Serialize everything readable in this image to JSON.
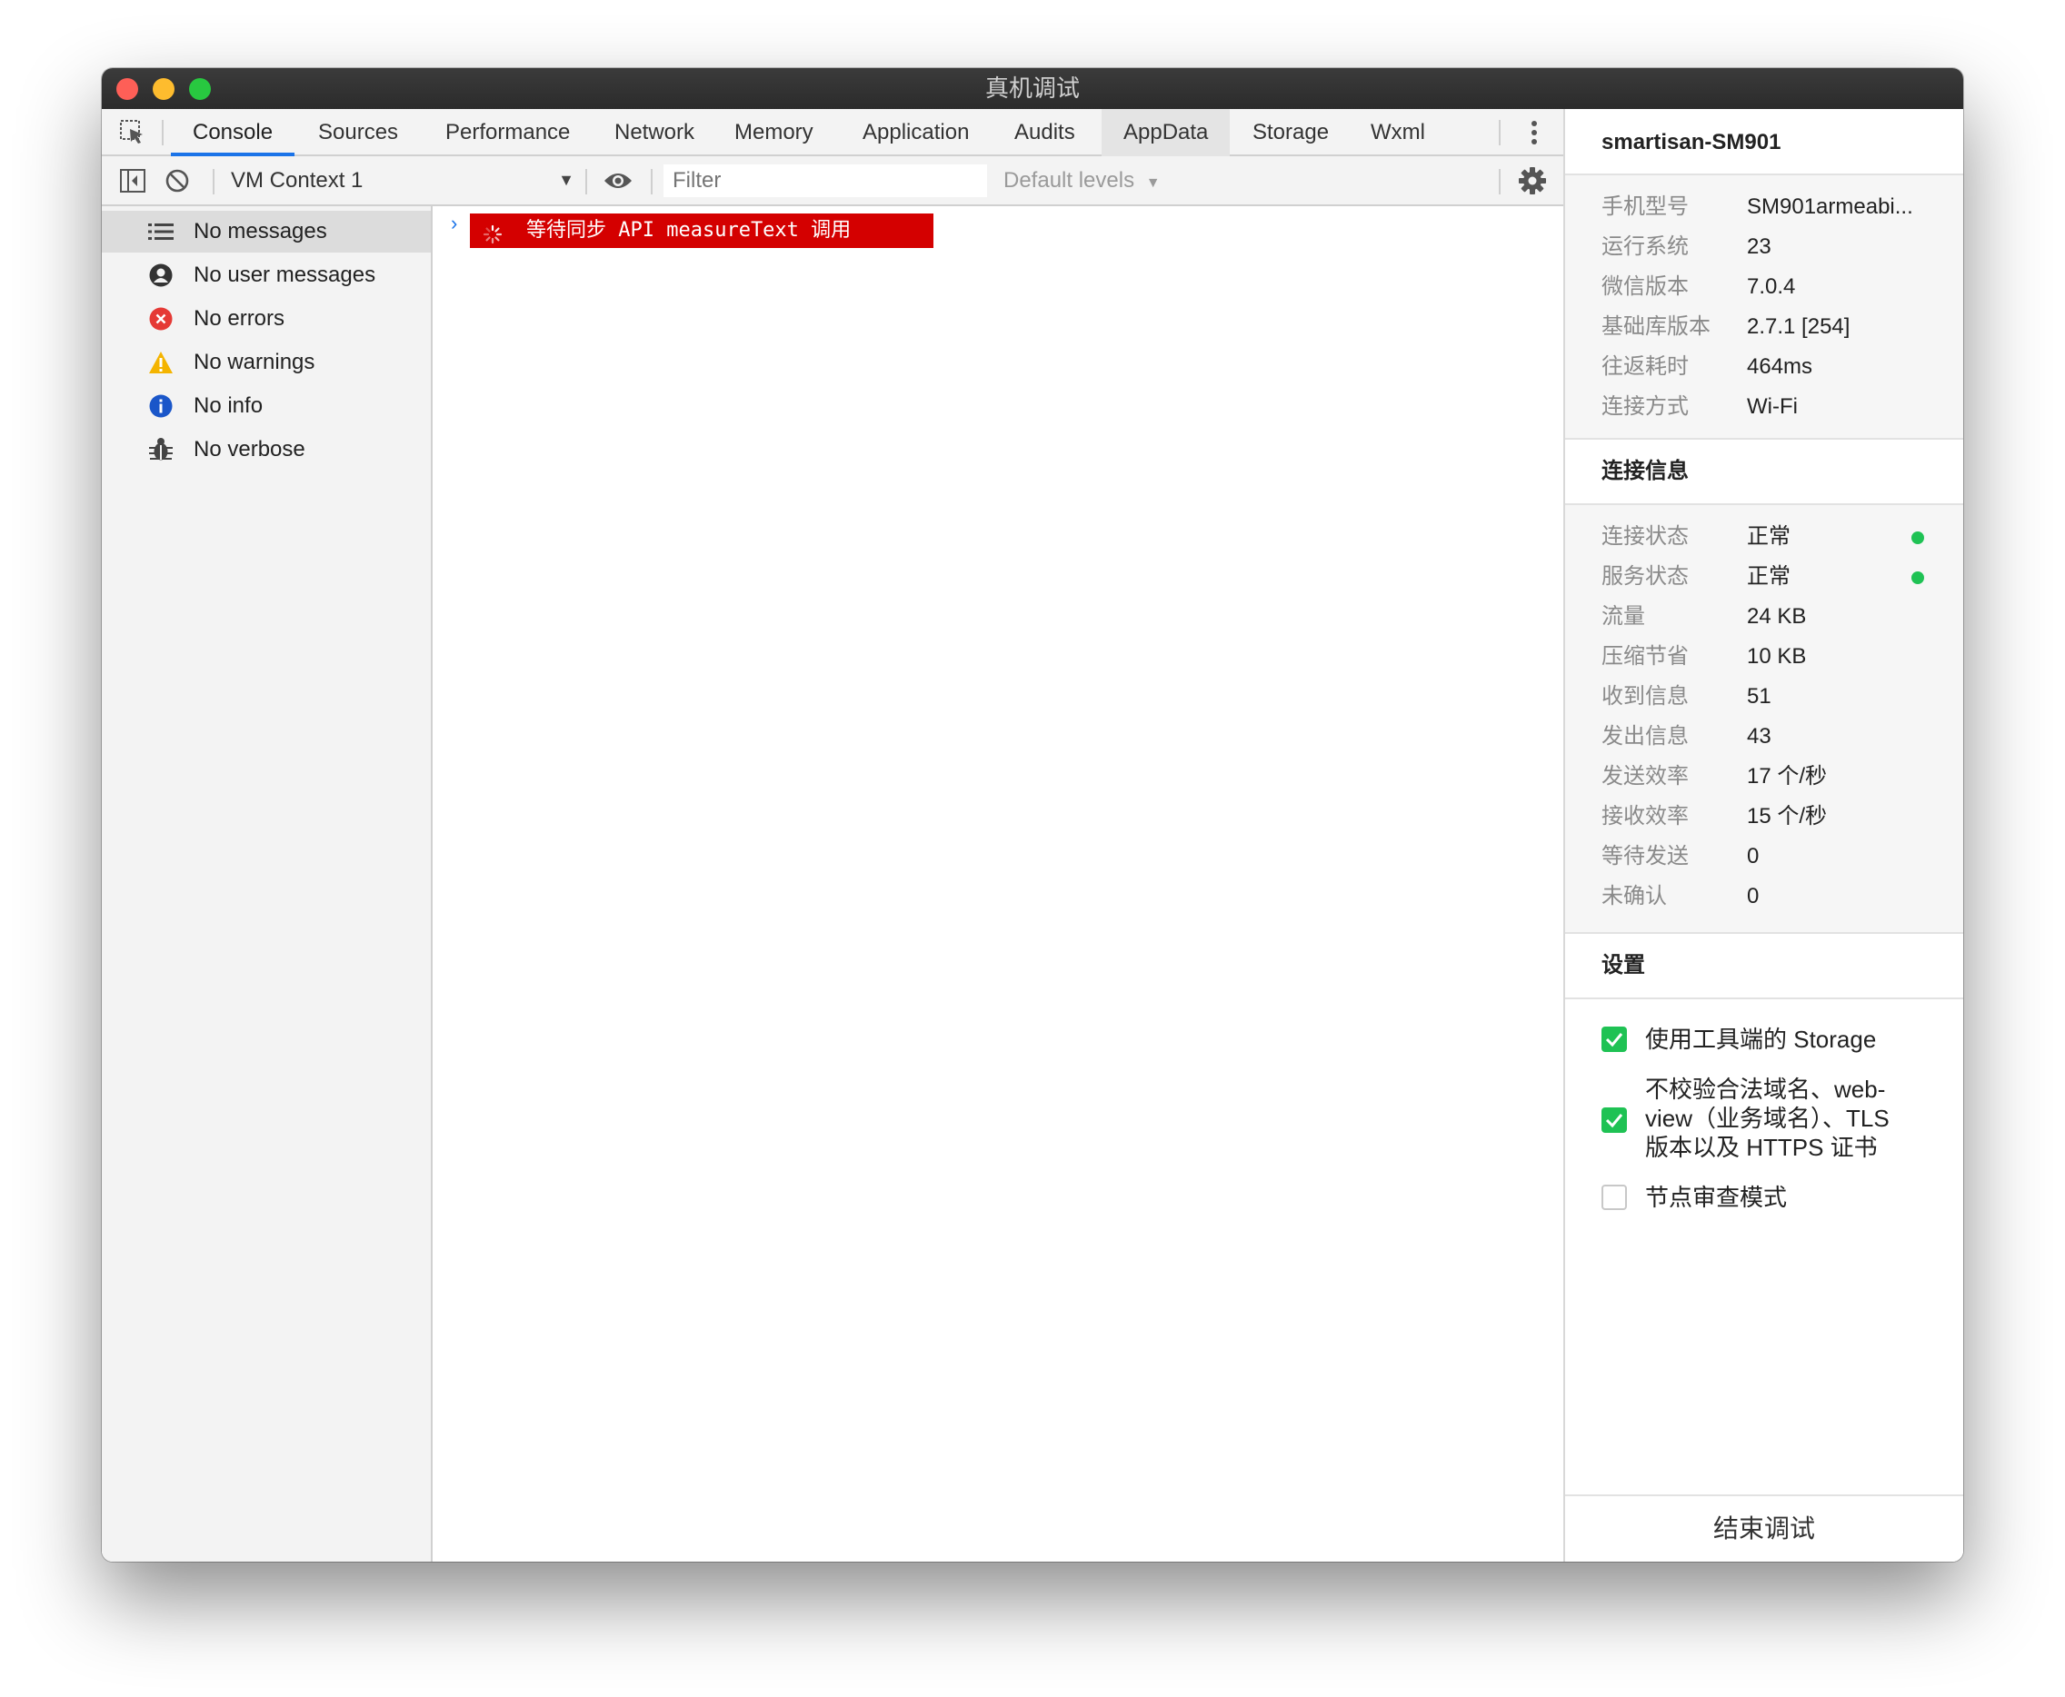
{
  "window": {
    "title": "真机调试"
  },
  "tabs": [
    {
      "label": "Console"
    },
    {
      "label": "Sources"
    },
    {
      "label": "Performance"
    },
    {
      "label": "Network"
    },
    {
      "label": "Memory"
    },
    {
      "label": "Application"
    },
    {
      "label": "Audits"
    },
    {
      "label": "AppData"
    },
    {
      "label": "Storage"
    },
    {
      "label": "Wxml"
    }
  ],
  "toolbar": {
    "context": "VM Context 1",
    "filter_placeholder": "Filter",
    "levels": "Default levels"
  },
  "sidebar": {
    "items": [
      {
        "label": "No messages",
        "icon": "list-icon"
      },
      {
        "label": "No user messages",
        "icon": "user-icon"
      },
      {
        "label": "No errors",
        "icon": "error-icon"
      },
      {
        "label": "No warnings",
        "icon": "warning-icon"
      },
      {
        "label": "No info",
        "icon": "info-icon"
      },
      {
        "label": "No verbose",
        "icon": "bug-icon"
      }
    ]
  },
  "console": {
    "message": "等待同步 API measureText 调用"
  },
  "device": {
    "name": "smartisan-SM901",
    "info": [
      {
        "key": "手机型号",
        "value": "SM901armeabi..."
      },
      {
        "key": "运行系统",
        "value": "23"
      },
      {
        "key": "微信版本",
        "value": "7.0.4"
      },
      {
        "key": "基础库版本",
        "value": "2.7.1 [254]"
      },
      {
        "key": "往返耗时",
        "value": "464ms"
      },
      {
        "key": "连接方式",
        "value": "Wi-Fi"
      }
    ]
  },
  "connection": {
    "title": "连接信息",
    "rows": [
      {
        "key": "连接状态",
        "value": "正常"
      },
      {
        "key": "服务状态",
        "value": "正常"
      },
      {
        "key": "流量",
        "value": "24 KB"
      },
      {
        "key": "压缩节省",
        "value": "10 KB"
      },
      {
        "key": "收到信息",
        "value": "51"
      },
      {
        "key": "发出信息",
        "value": "43"
      },
      {
        "key": "发送效率",
        "value": "17 个/秒"
      },
      {
        "key": "接收效率",
        "value": "15 个/秒"
      },
      {
        "key": "等待发送",
        "value": "0"
      },
      {
        "key": "未确认",
        "value": "0"
      }
    ],
    "status_color": "#1fc254"
  },
  "settings": {
    "title": "设置",
    "items": [
      {
        "label": "使用工具端的 Storage",
        "checked": true
      },
      {
        "line1": "不校验合法域名、web-",
        "line2": "view（业务域名）、TLS",
        "line3": "版本以及 HTTPS 证书",
        "checked": true
      },
      {
        "label": "节点审查模式",
        "checked": false
      }
    ]
  },
  "end_button": "结束调试",
  "colors": {
    "accent": "#1a73e8",
    "error_bg": "#d40000",
    "check_green": "#1fc254"
  }
}
